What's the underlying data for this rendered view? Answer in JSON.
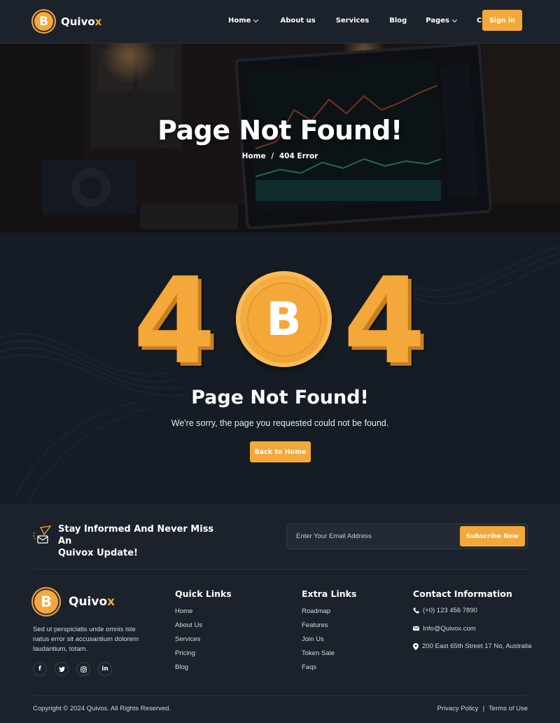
{
  "brand": {
    "name_main": "Quivo",
    "name_accent": "x",
    "coin_symbol": "B"
  },
  "nav": {
    "items": [
      {
        "label": "Home",
        "dropdown": true
      },
      {
        "label": "About us",
        "dropdown": false
      },
      {
        "label": "Services",
        "dropdown": false
      },
      {
        "label": "Blog",
        "dropdown": false
      },
      {
        "label": "Pages",
        "dropdown": true
      },
      {
        "label": "Contact",
        "dropdown": false
      }
    ],
    "signin_label": "Sign in"
  },
  "hero": {
    "title": "Page Not Found!",
    "breadcrumb": {
      "home": "Home",
      "separator": "/",
      "current": "404 Error"
    }
  },
  "error": {
    "digit_left": "4",
    "digit_right": "4",
    "coin_symbol": "B",
    "title": "Page Not Found!",
    "message": "We're sorry, the page you requested could not be found.",
    "button_label": "Back to Home"
  },
  "newsletter": {
    "title_line1": "Stay Informed And Never Miss An",
    "title_line2": "Quivox Update!",
    "placeholder": "Enter Your Email Address",
    "button_label": "Subscribe Now"
  },
  "footer": {
    "description": "Sed ut perspiciatis unde omnis iste natus error sit accusantium dolorem laudantium, totam.",
    "socials": [
      "facebook-icon",
      "twitter-icon",
      "instagram-icon",
      "linkedin-icon"
    ],
    "quick_links": {
      "title": "Quick Links",
      "items": [
        "Home",
        "About Us",
        "Services",
        "Pricing",
        "Blog"
      ]
    },
    "extra_links": {
      "title": "Extra Links",
      "items": [
        "Roadmap",
        "Features",
        "Join Us",
        "Token Sale",
        "Faqs"
      ]
    },
    "contact": {
      "title": "Contact Information",
      "phone": "(+0) 123 456 7890",
      "email": "Info@Quivox.com",
      "address": "200 East 65th Street 17 No, Australia"
    },
    "copyright": "Copyright © 2024 Quivox. All Rights Reserved.",
    "privacy": "Privacy Policy",
    "legal_sep": "|",
    "terms": "Terms of Use"
  },
  "colors": {
    "accent": "#f4a83a",
    "bg": "#161c25",
    "panel": "#1c222c"
  }
}
